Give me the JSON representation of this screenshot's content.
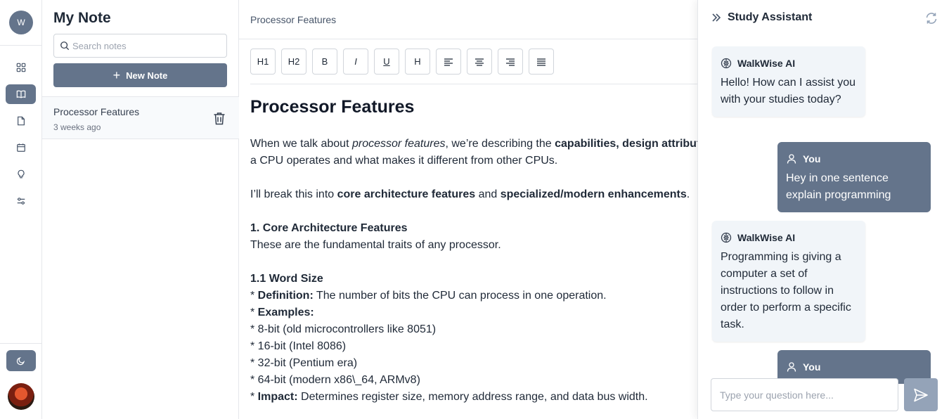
{
  "rail": {
    "user_initial": "W",
    "nav": [
      "dashboard-icon",
      "book-icon",
      "file-icon",
      "calendar-icon",
      "lightbulb-icon",
      "settings-sliders-icon"
    ],
    "active_index": 1
  },
  "notes_panel": {
    "title": "My Note",
    "search_placeholder": "Search notes",
    "new_note_label": "New Note",
    "items": [
      {
        "title": "Processor Features",
        "date": "3 weeks ago"
      }
    ]
  },
  "editor": {
    "breadcrumb": "Processor Features",
    "toolbar": [
      "H1",
      "H2",
      "B",
      "I",
      "U",
      "H"
    ],
    "doc_title": "Processor Features",
    "lines": {
      "p1a_pre": "When we talk about ",
      "p1a_em": "processor features",
      "p1a_mid": ", we’re describing the ",
      "p1a_bold": "capabilities, design attributes, and technologies",
      "p1b": "a CPU operates and what makes it different from other CPUs.",
      "p2_pre": "I’ll break this into ",
      "p2_b1": "core architecture features",
      "p2_mid": " and ",
      "p2_b2": "specialized/modern enhancements",
      "p2_post": ".",
      "h1": "1. Core Architecture Features",
      "h1_desc": "These are the fundamental traits of any processor.",
      "h2": "1.1 Word Size",
      "def_pre": "* ",
      "def_label": "Definition:",
      "def_text": " The number of bits the CPU can process in one operation.",
      "ex_pre": "* ",
      "ex_label": "Examples:",
      "e1": "* 8-bit (old microcontrollers like 8051)",
      "e2": "* 16-bit (Intel 8086)",
      "e3": "* 32-bit (Pentium era)",
      "e4": "* 64-bit (modern x86\\_64, ARMv8)",
      "imp_pre": "* ",
      "imp_label": "Impact:",
      "imp_text": " Determines register size, memory address range, and data bus width."
    }
  },
  "assistant": {
    "title": "Study Assistant",
    "input_placeholder": "Type your question here...",
    "messages": [
      {
        "from": "WalkWise AI",
        "text": "Hello! How can I assist you with your studies today?"
      },
      {
        "from": "You",
        "text": "Hey in one sentence explain programming"
      },
      {
        "from": "WalkWise AI",
        "text": "Programming is giving a computer a set of instructions to follow in order to perform a specific task."
      },
      {
        "from": "You",
        "text": ""
      }
    ]
  },
  "colors": {
    "accent": "#64748b",
    "border": "#e5e7eb"
  }
}
